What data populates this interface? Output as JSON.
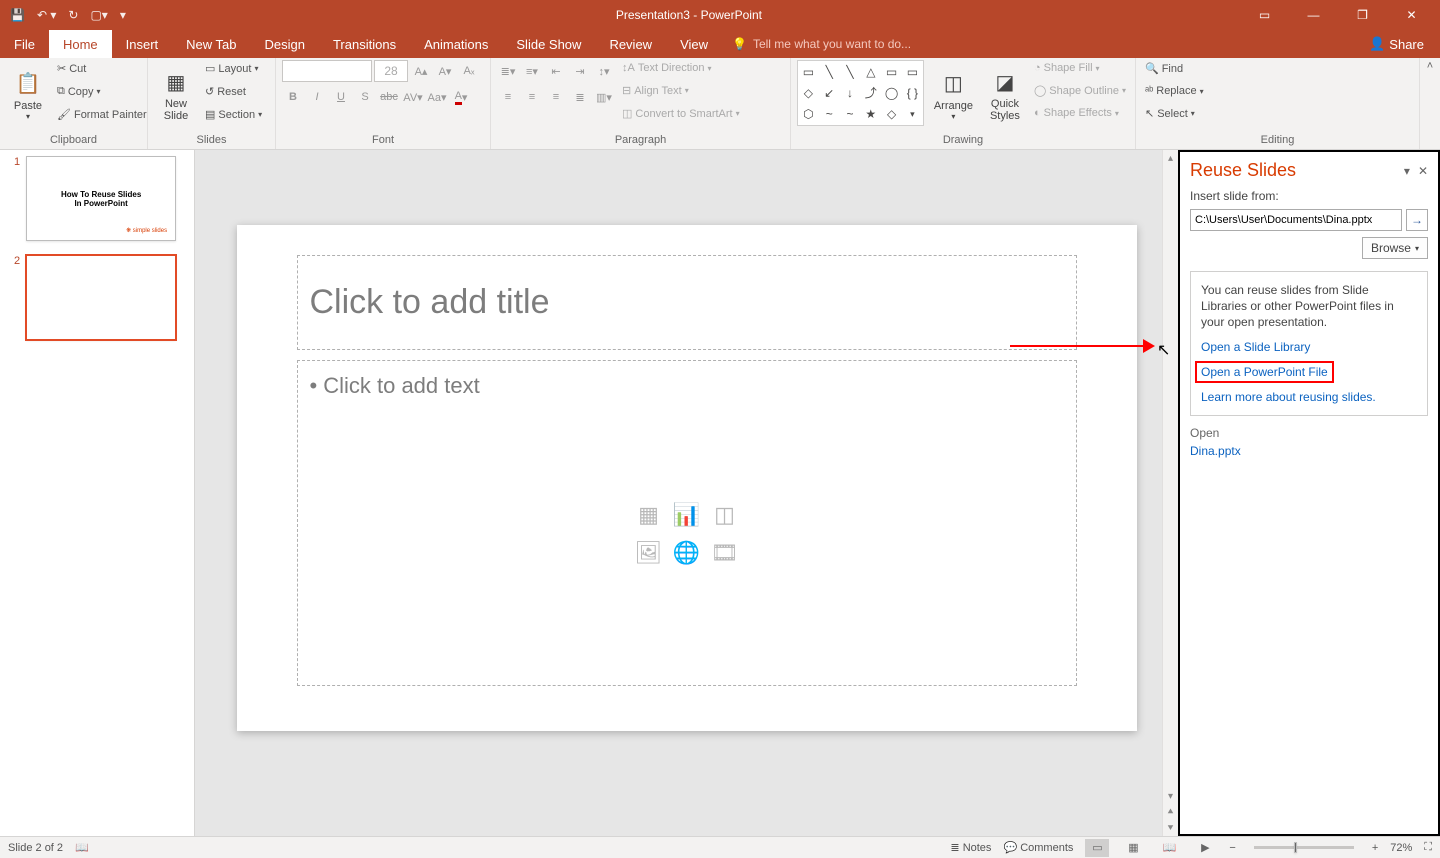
{
  "window": {
    "title": "Presentation3 - PowerPoint",
    "share": "Share"
  },
  "tabs": {
    "file": "File",
    "home": "Home",
    "insert": "Insert",
    "newtab": "New Tab",
    "design": "Design",
    "transitions": "Transitions",
    "animations": "Animations",
    "slideshow": "Slide Show",
    "review": "Review",
    "view": "View",
    "tellme": "Tell me what you want to do..."
  },
  "ribbon": {
    "clipboard": {
      "label": "Clipboard",
      "paste": "Paste",
      "cut": "Cut",
      "copy": "Copy",
      "format_painter": "Format Painter"
    },
    "slides": {
      "label": "Slides",
      "new_slide": "New\nSlide",
      "layout": "Layout",
      "reset": "Reset",
      "section": "Section"
    },
    "font": {
      "label": "Font",
      "size": "28"
    },
    "paragraph": {
      "label": "Paragraph",
      "text_direction": "Text Direction",
      "align_text": "Align Text",
      "convert_smartart": "Convert to SmartArt"
    },
    "drawing": {
      "label": "Drawing",
      "arrange": "Arrange",
      "quick_styles": "Quick\nStyles",
      "shape_fill": "Shape Fill",
      "shape_outline": "Shape Outline",
      "shape_effects": "Shape Effects"
    },
    "editing": {
      "label": "Editing",
      "find": "Find",
      "replace": "Replace",
      "select": "Select"
    }
  },
  "thumbs": {
    "n1": "1",
    "n2": "2",
    "slide1_line1": "How To Reuse Slides",
    "slide1_line2": "In PowerPoint",
    "slide1_badge": "simple slides"
  },
  "canvas": {
    "title_placeholder": "Click to add title",
    "body_placeholder": "Click to add text"
  },
  "reuse": {
    "title": "Reuse Slides",
    "insert_from_label": "Insert slide from:",
    "path_value": "C:\\Users\\User\\Documents\\Dina.pptx",
    "browse": "Browse",
    "help_text": "You can reuse slides from Slide Libraries or other PowerPoint files in your open presentation.",
    "open_library": "Open a Slide Library",
    "open_file": "Open a PowerPoint File",
    "learn_more": "Learn more about reusing slides.",
    "open_header": "Open",
    "recent_file": "Dina.pptx"
  },
  "status": {
    "slide_info": "Slide 2 of 2",
    "notes": "Notes",
    "comments": "Comments",
    "zoom": "72%"
  }
}
